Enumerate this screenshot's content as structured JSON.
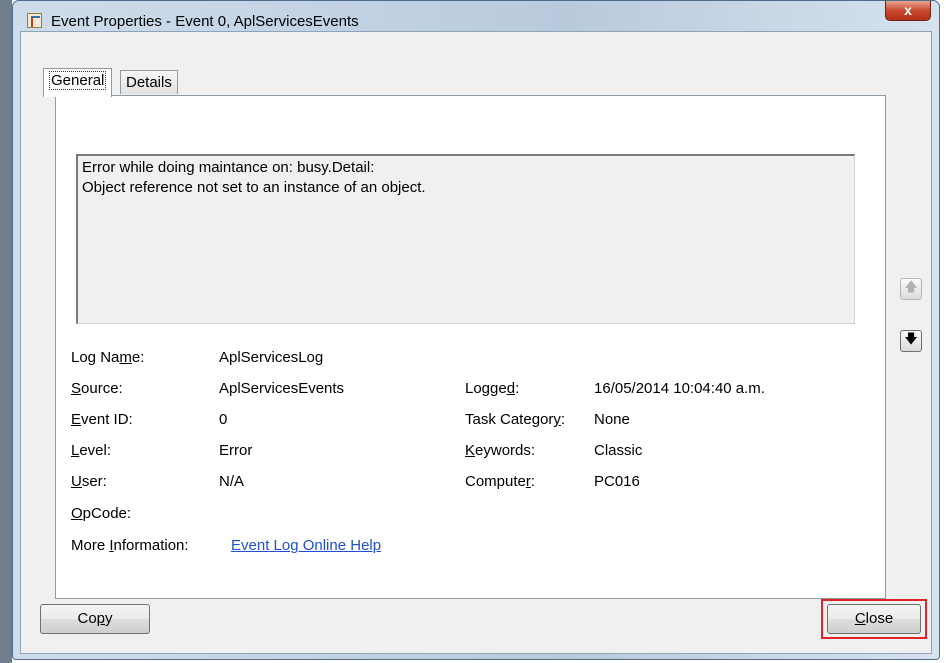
{
  "window": {
    "title": "Event Properties - Event 0, AplServicesEvents",
    "close_glyph": "x",
    "icon": "event-viewer-icon"
  },
  "tabs": [
    {
      "label": "General",
      "active": true
    },
    {
      "label": "Details",
      "active": false
    }
  ],
  "description": {
    "line1": "Error while doing maintance on: busy.Detail:",
    "line2": "Object reference not set to an instance of an object."
  },
  "fields": {
    "log_name": {
      "label_pre": "Log Na",
      "label_ul": "m",
      "label_post": "e:",
      "value": "AplServicesLog"
    },
    "source": {
      "label_pre": "",
      "label_ul": "S",
      "label_post": "ource:",
      "value": "AplServicesEvents"
    },
    "event_id": {
      "label_pre": "",
      "label_ul": "E",
      "label_post": "vent ID:",
      "value": "0"
    },
    "level": {
      "label_pre": "",
      "label_ul": "L",
      "label_post": "evel:",
      "value": "Error"
    },
    "user": {
      "label_pre": "",
      "label_ul": "U",
      "label_post": "ser:",
      "value": "N/A"
    },
    "opcode": {
      "label_pre": "",
      "label_ul": "O",
      "label_post": "pCode:",
      "value": ""
    },
    "more_info": {
      "label_pre": "More ",
      "label_ul": "I",
      "label_post": "nformation:",
      "value": "Event Log Online Help"
    },
    "logged": {
      "label_pre": "Logge",
      "label_ul": "d",
      "label_post": ":",
      "value": "16/05/2014 10:04:40 a.m."
    },
    "task_category": {
      "label_pre": "Task Categor",
      "label_ul": "y",
      "label_post": ":",
      "value": "None"
    },
    "keywords": {
      "label_pre": "",
      "label_ul": "K",
      "label_post": "eywords:",
      "value": "Classic"
    },
    "computer": {
      "label_pre": "Compute",
      "label_ul": "r",
      "label_post": ":",
      "value": "PC016"
    }
  },
  "nav": {
    "up_icon": "arrow-up-icon",
    "down_icon": "arrow-down-icon",
    "up_glyph": "🡅",
    "down_glyph": "🡇"
  },
  "buttons": {
    "copy": {
      "label_pre": "Co",
      "label_ul": "p",
      "label_post": "y"
    },
    "close": {
      "label_pre": "",
      "label_ul": "C",
      "label_post": "lose"
    }
  },
  "colors": {
    "highlight": "#e0242a",
    "link": "#1f4fd6",
    "close_button": "#c8472e"
  }
}
